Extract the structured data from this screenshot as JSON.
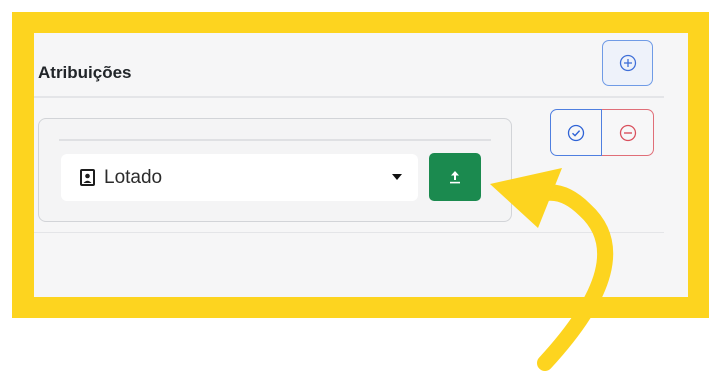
{
  "section": {
    "title": "Atribuições"
  },
  "assignment": {
    "selected_value": "Lotado"
  },
  "icons": {
    "add": "plus-circle-icon",
    "confirm": "check-circle-icon",
    "remove": "minus-circle-icon",
    "option": "badge-icon",
    "dropdown": "caret-down-icon",
    "upload": "upload-icon",
    "annotation": "curved-arrow-icon"
  },
  "colors": {
    "highlight": "#fdd41f",
    "panel": "#f6f6f7",
    "add_border": "#6f9be6",
    "confirm_border": "#4f7fe0",
    "remove_border": "#e06e78",
    "upload_button": "#1b8a4f",
    "arrow": "#fdd41f"
  }
}
